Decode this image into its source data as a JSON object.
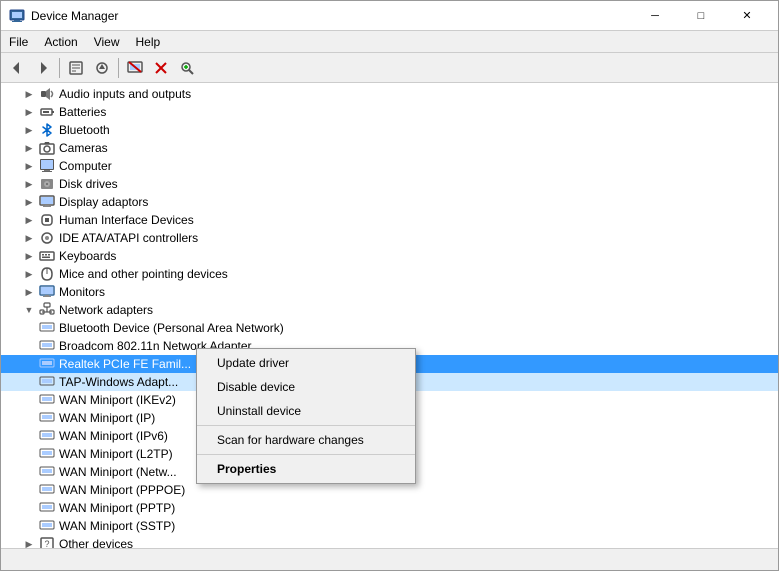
{
  "window": {
    "title": "Device Manager",
    "icon": "🖥️"
  },
  "menu": {
    "items": [
      "File",
      "Action",
      "View",
      "Help"
    ]
  },
  "toolbar": {
    "buttons": [
      {
        "name": "back-btn",
        "icon": "◁",
        "label": "Back"
      },
      {
        "name": "forward-btn",
        "icon": "▷",
        "label": "Forward"
      },
      {
        "name": "properties-btn",
        "icon": "📋",
        "label": "Properties"
      },
      {
        "name": "update-driver-btn",
        "icon": "🔄",
        "label": "Update Driver"
      },
      {
        "name": "uninstall-btn",
        "icon": "❌",
        "label": "Uninstall"
      },
      {
        "name": "scan-btn",
        "icon": "🔍",
        "label": "Scan"
      },
      {
        "name": "add-hardware-btn",
        "icon": "➕",
        "label": "Add Hardware"
      }
    ]
  },
  "tree": {
    "items": [
      {
        "id": "audio",
        "level": 1,
        "icon": "🔊",
        "label": "Audio inputs and outputs",
        "expanded": false,
        "type": "category"
      },
      {
        "id": "batteries",
        "level": 1,
        "icon": "🔋",
        "label": "Batteries",
        "expanded": false,
        "type": "category"
      },
      {
        "id": "bluetooth",
        "level": 1,
        "icon": "🔵",
        "label": "Bluetooth",
        "expanded": false,
        "type": "category"
      },
      {
        "id": "cameras",
        "level": 1,
        "icon": "📷",
        "label": "Cameras",
        "expanded": false,
        "type": "category"
      },
      {
        "id": "computer",
        "level": 1,
        "icon": "💻",
        "label": "Computer",
        "expanded": false,
        "type": "category"
      },
      {
        "id": "disk",
        "level": 1,
        "icon": "💾",
        "label": "Disk drives",
        "expanded": false,
        "type": "category"
      },
      {
        "id": "display",
        "level": 1,
        "icon": "🖥️",
        "label": "Display adaptors",
        "expanded": false,
        "type": "category"
      },
      {
        "id": "hid",
        "level": 1,
        "icon": "🖱️",
        "label": "Human Interface Devices",
        "expanded": false,
        "type": "category"
      },
      {
        "id": "ide",
        "level": 1,
        "icon": "💿",
        "label": "IDE ATA/ATAPI controllers",
        "expanded": false,
        "type": "category"
      },
      {
        "id": "keyboards",
        "level": 1,
        "icon": "⌨️",
        "label": "Keyboards",
        "expanded": false,
        "type": "category"
      },
      {
        "id": "mice",
        "level": 1,
        "icon": "🖱️",
        "label": "Mice and other pointing devices",
        "expanded": false,
        "type": "category"
      },
      {
        "id": "monitors",
        "level": 1,
        "icon": "🖥️",
        "label": "Monitors",
        "expanded": false,
        "type": "category"
      },
      {
        "id": "network",
        "level": 1,
        "icon": "🌐",
        "label": "Network adapters",
        "expanded": true,
        "type": "category"
      },
      {
        "id": "net-bt",
        "level": 2,
        "icon": "📡",
        "label": "Bluetooth Device (Personal Area Network)",
        "type": "device"
      },
      {
        "id": "net-broadcom",
        "level": 2,
        "icon": "📡",
        "label": "Broadcom 802.11n Network Adapter",
        "type": "device"
      },
      {
        "id": "net-realtek",
        "level": 2,
        "icon": "📡",
        "label": "Realtek PCIe FE Famil...",
        "type": "device",
        "selected": true
      },
      {
        "id": "net-tap",
        "level": 2,
        "icon": "📡",
        "label": "TAP-Windows Adapt...",
        "type": "device"
      },
      {
        "id": "net-wan-ikev2",
        "level": 2,
        "icon": "📡",
        "label": "WAN Miniport (IKEv2)",
        "type": "device"
      },
      {
        "id": "net-wan-ip",
        "level": 2,
        "icon": "📡",
        "label": "WAN Miniport (IP)",
        "type": "device"
      },
      {
        "id": "net-wan-ipv6",
        "level": 2,
        "icon": "📡",
        "label": "WAN Miniport (IPv6)",
        "type": "device"
      },
      {
        "id": "net-wan-l2tp",
        "level": 2,
        "icon": "📡",
        "label": "WAN Miniport (L2TP)",
        "type": "device"
      },
      {
        "id": "net-wan-netw",
        "level": 2,
        "icon": "📡",
        "label": "WAN Miniport (Netw...",
        "type": "device"
      },
      {
        "id": "net-wan-ppoe",
        "level": 2,
        "icon": "📡",
        "label": "WAN Miniport (PPPOE)",
        "type": "device"
      },
      {
        "id": "net-wan-pptp",
        "level": 2,
        "icon": "📡",
        "label": "WAN Miniport (PPTP)",
        "type": "device"
      },
      {
        "id": "net-wan-sstp",
        "level": 2,
        "icon": "📡",
        "label": "WAN Miniport (SSTP)",
        "type": "device"
      },
      {
        "id": "other",
        "level": 1,
        "icon": "📦",
        "label": "Other devices",
        "expanded": false,
        "type": "category"
      }
    ]
  },
  "context_menu": {
    "visible": true,
    "items": [
      {
        "id": "update-driver",
        "label": "Update driver",
        "bold": false
      },
      {
        "id": "disable-device",
        "label": "Disable device",
        "bold": false
      },
      {
        "id": "uninstall-device",
        "label": "Uninstall device",
        "bold": false
      },
      {
        "id": "sep1",
        "type": "separator"
      },
      {
        "id": "scan-hardware",
        "label": "Scan for hardware changes",
        "bold": false
      },
      {
        "id": "sep2",
        "type": "separator"
      },
      {
        "id": "properties",
        "label": "Properties",
        "bold": true
      }
    ]
  },
  "status_bar": {
    "text": ""
  },
  "colors": {
    "selected_bg": "#3399ff",
    "selected_text": "#ffffff",
    "highlight_bg": "#cce8ff",
    "context_bold": "#000000"
  }
}
